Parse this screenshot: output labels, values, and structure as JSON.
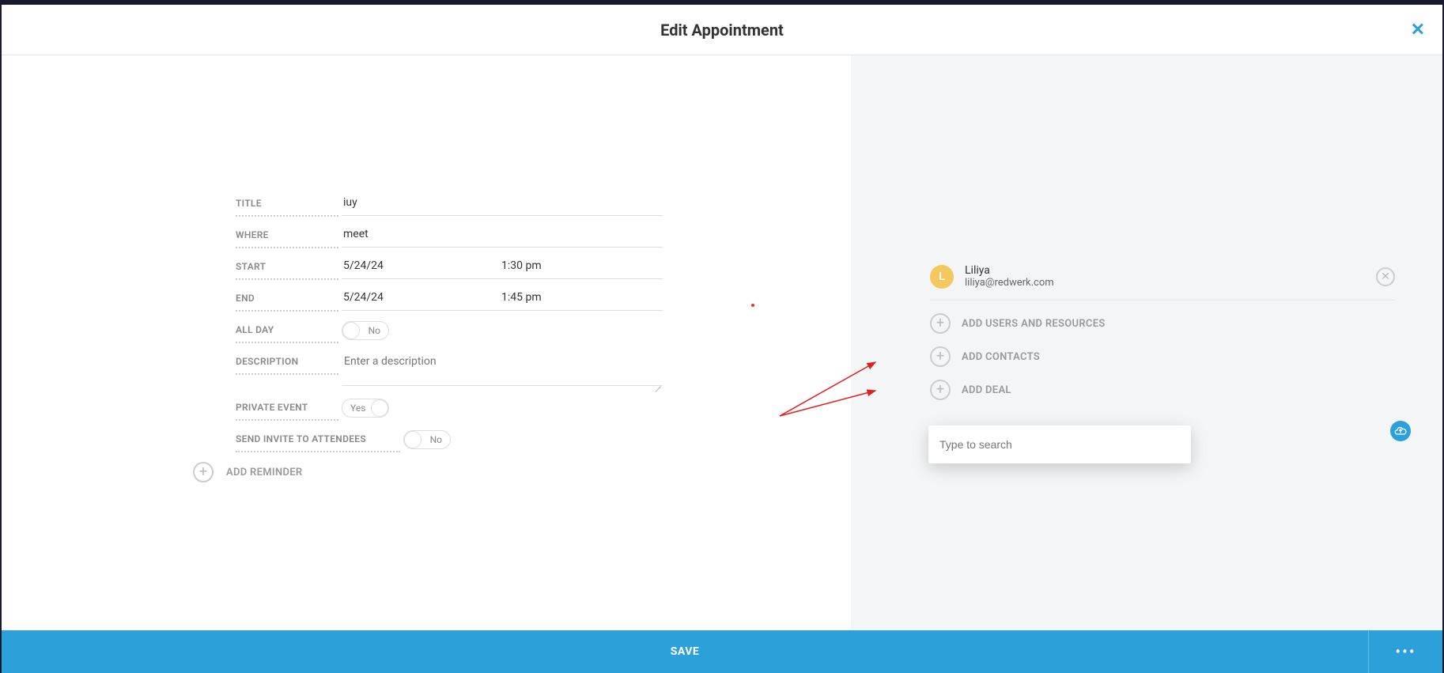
{
  "header": {
    "title": "Edit Appointment"
  },
  "form": {
    "labels": {
      "title": "TITLE",
      "where": "WHERE",
      "start": "START",
      "end": "END",
      "allDay": "ALL DAY",
      "description": "DESCRIPTION",
      "privateEvent": "PRIVATE EVENT",
      "sendInvite": "SEND INVITE TO ATTENDEES",
      "addReminder": "ADD REMINDER"
    },
    "values": {
      "title": "iuy",
      "where": "meet",
      "startDate": "5/24/24",
      "startTime": "1:30 pm",
      "endDate": "5/24/24",
      "endTime": "1:45 pm",
      "description": "",
      "descriptionPlaceholder": "Enter a description"
    },
    "toggles": {
      "allDay": {
        "state": "off",
        "text": "No"
      },
      "privateEvent": {
        "state": "on",
        "text": "Yes"
      },
      "sendInvite": {
        "state": "off",
        "text": "No"
      }
    }
  },
  "rightPanel": {
    "attendee": {
      "initial": "L",
      "name": "Liliya",
      "email": "liliya@redwerk.com"
    },
    "actions": {
      "addUsers": "ADD USERS AND RESOURCES",
      "addContacts": "ADD CONTACTS",
      "addDeal": "ADD DEAL"
    },
    "search": {
      "placeholder": "Type to search"
    }
  },
  "footer": {
    "save": "SAVE",
    "more": "•••"
  }
}
